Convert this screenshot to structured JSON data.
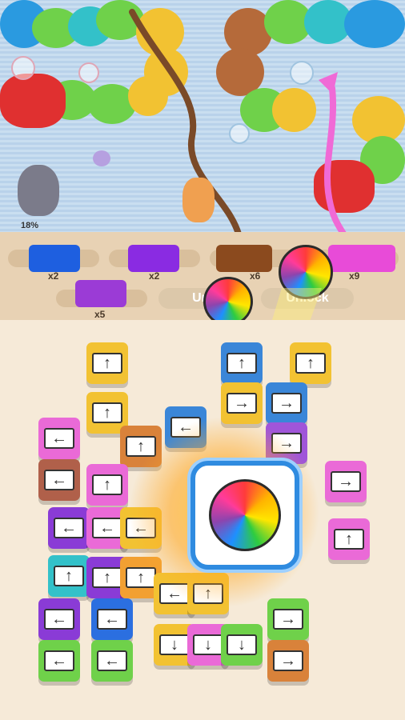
{
  "game": {
    "progress_label": "18%",
    "progress_value": 18,
    "spools": [
      {
        "color": "#1e5fe0",
        "multiplier": "x2"
      },
      {
        "color": "#8a2be2",
        "multiplier": "x2"
      },
      {
        "color": "#8b4a1e",
        "multiplier": "x6"
      },
      {
        "color": "#e84bd8",
        "multiplier": "x9"
      },
      {
        "color": "#9b3bd6",
        "multiplier": "x5"
      }
    ],
    "unlock_buttons": [
      "Unl",
      "Unlock"
    ],
    "center_card_icon": "yarn-ball-icon",
    "colors": {
      "wall": "#c9def0",
      "shelf": "#e8d2b4",
      "board": "#f6ead8",
      "card_border": "#2f8be0"
    }
  },
  "tiles": [
    {
      "c": "#f2c232",
      "a": "↑"
    },
    {
      "c": "#3a86d8",
      "a": "↑"
    },
    {
      "c": "#f2c232",
      "a": "↑"
    },
    {
      "c": "#f2c232",
      "a": "↑"
    },
    {
      "c": "#f2c232",
      "a": "→"
    },
    {
      "c": "#3a86d8",
      "a": "→"
    },
    {
      "c": "#ea6ad7",
      "a": "←"
    },
    {
      "c": "#3a86d8",
      "a": "←"
    },
    {
      "c": "#d9823a",
      "a": "↑"
    },
    {
      "c": "#a055d9",
      "a": "→"
    },
    {
      "c": "#b0604a",
      "a": "←"
    },
    {
      "c": "#ea6ad7",
      "a": "↑"
    },
    {
      "c": "#ea6ad7",
      "a": "→"
    },
    {
      "c": "#8a3bd6",
      "a": "←"
    },
    {
      "c": "#ea6ad7",
      "a": "←"
    },
    {
      "c": "#f2c232",
      "a": "←"
    },
    {
      "c": "#ea6ad7",
      "a": "↑"
    },
    {
      "c": "#33c1c9",
      "a": "↑"
    },
    {
      "c": "#8a3bd6",
      "a": "↑"
    },
    {
      "c": "#f2a032",
      "a": "↑"
    },
    {
      "c": "#8a3bd6",
      "a": "←"
    },
    {
      "c": "#2b6fe0",
      "a": "←"
    },
    {
      "c": "#f2c232",
      "a": "←"
    },
    {
      "c": "#f2c232",
      "a": "↑"
    },
    {
      "c": "#6fd14a",
      "a": "→"
    },
    {
      "c": "#6fd14a",
      "a": "←"
    },
    {
      "c": "#6fd14a",
      "a": "←"
    },
    {
      "c": "#f2c232",
      "a": "↓"
    },
    {
      "c": "#ea6ad7",
      "a": "↓"
    },
    {
      "c": "#6fd14a",
      "a": "↓"
    },
    {
      "c": "#d9823a",
      "a": "→"
    }
  ]
}
